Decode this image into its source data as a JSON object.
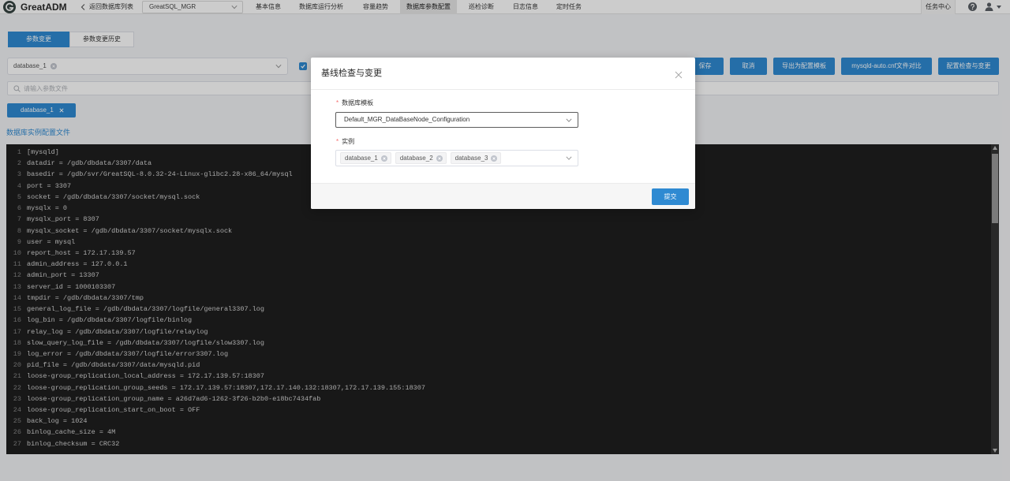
{
  "colors": {
    "primary": "#2f8ad2",
    "required": "#f56c6c",
    "editor_bg": "#1e1e1e",
    "overlay": "rgba(0,0,0,0.2)"
  },
  "icons": {
    "logo": "greatadm-logo-icon",
    "back": "chevron-left-icon",
    "dropdown": "chevron-down-icon",
    "help": "help-circle-icon",
    "user": "user-icon",
    "search": "search-icon",
    "tag_clear": "close-circle-icon",
    "close": "close-icon",
    "checkbox": "check-icon"
  },
  "header": {
    "logo_text": "GreatADM",
    "back_label": "返回数据库列表",
    "cluster_select": "GreatSQL_MGR",
    "nav": [
      {
        "label": "基本信息",
        "active": false
      },
      {
        "label": "数据库运行分析",
        "active": false
      },
      {
        "label": "容量趋势",
        "active": false
      },
      {
        "label": "数据库参数配置",
        "active": true
      },
      {
        "label": "巡检诊断",
        "active": false
      },
      {
        "label": "日志信息",
        "active": false
      },
      {
        "label": "定时任务",
        "active": false
      }
    ],
    "task_center": "任务中心"
  },
  "tabs": [
    {
      "label": "参数变更",
      "active": true
    },
    {
      "label": "参数变更历史",
      "active": false
    }
  ],
  "toolbar": {
    "instance_select": "database_1",
    "checkbox_checked": true,
    "buttons": {
      "save": "保存",
      "cancel": "取消",
      "export_template": "导出为配置模板",
      "compare_auto_cnf": "mysqld-auto.cnf文件对比",
      "check_and_change": "配置检查与变更"
    }
  },
  "search": {
    "placeholder": "请输入参数文件"
  },
  "instance_tab": {
    "label": "database_1"
  },
  "config_section_title": "数据库实例配置文件",
  "editor": {
    "lines": [
      {
        "n": 1,
        "text": "[mysqld]"
      },
      {
        "n": 2,
        "text": "datadir = /gdb/dbdata/3307/data"
      },
      {
        "n": 3,
        "text": "basedir = /gdb/svr/GreatSQL-8.0.32-24-Linux-glibc2.28-x86_64/mysql"
      },
      {
        "n": 4,
        "text": "port = 3307"
      },
      {
        "n": 5,
        "text": "socket = /gdb/dbdata/3307/socket/mysql.sock"
      },
      {
        "n": 6,
        "text": "mysqlx = 0"
      },
      {
        "n": 7,
        "text": "mysqlx_port = 8307"
      },
      {
        "n": 8,
        "text": "mysqlx_socket = /gdb/dbdata/3307/socket/mysqlx.sock"
      },
      {
        "n": 9,
        "text": "user = mysql"
      },
      {
        "n": 10,
        "text": "report_host = 172.17.139.57"
      },
      {
        "n": 11,
        "text": "admin_address = 127.0.0.1"
      },
      {
        "n": 12,
        "text": "admin_port = 13307"
      },
      {
        "n": 13,
        "text": "server_id = 1000103307"
      },
      {
        "n": 14,
        "text": "tmpdir = /gdb/dbdata/3307/tmp"
      },
      {
        "n": 15,
        "text": "general_log_file = /gdb/dbdata/3307/logfile/general3307.log"
      },
      {
        "n": 16,
        "text": "log_bin = /gdb/dbdata/3307/logfile/binlog"
      },
      {
        "n": 17,
        "text": "relay_log = /gdb/dbdata/3307/logfile/relaylog"
      },
      {
        "n": 18,
        "text": "slow_query_log_file = /gdb/dbdata/3307/logfile/slow3307.log"
      },
      {
        "n": 19,
        "text": "log_error = /gdb/dbdata/3307/logfile/error3307.log"
      },
      {
        "n": 20,
        "text": "pid_file = /gdb/dbdata/3307/data/mysqld.pid"
      },
      {
        "n": 21,
        "text": "loose-group_replication_local_address = 172.17.139.57:18307"
      },
      {
        "n": 22,
        "text": "loose-group_replication_group_seeds = 172.17.139.57:18307,172.17.140.132:18307,172.17.139.155:18307"
      },
      {
        "n": 23,
        "text": "loose-group_replication_group_name = a26d7ad6-1262-3f26-b2b0-e18bc7434fab"
      },
      {
        "n": 24,
        "text": "loose-group_replication_start_on_boot = OFF"
      },
      {
        "n": 25,
        "text": "back_log = 1024"
      },
      {
        "n": 26,
        "text": "binlog_cache_size = 4M"
      },
      {
        "n": 27,
        "text": "binlog_checksum = CRC32"
      }
    ]
  },
  "modal": {
    "title": "基线检查与变更",
    "required_mark": "*",
    "template": {
      "label": "数据库模板",
      "value": "Default_MGR_DataBaseNode_Configuration"
    },
    "instances": {
      "label": "实例",
      "tags": [
        "database_1",
        "database_2",
        "database_3"
      ]
    },
    "submit_label": "提交"
  }
}
